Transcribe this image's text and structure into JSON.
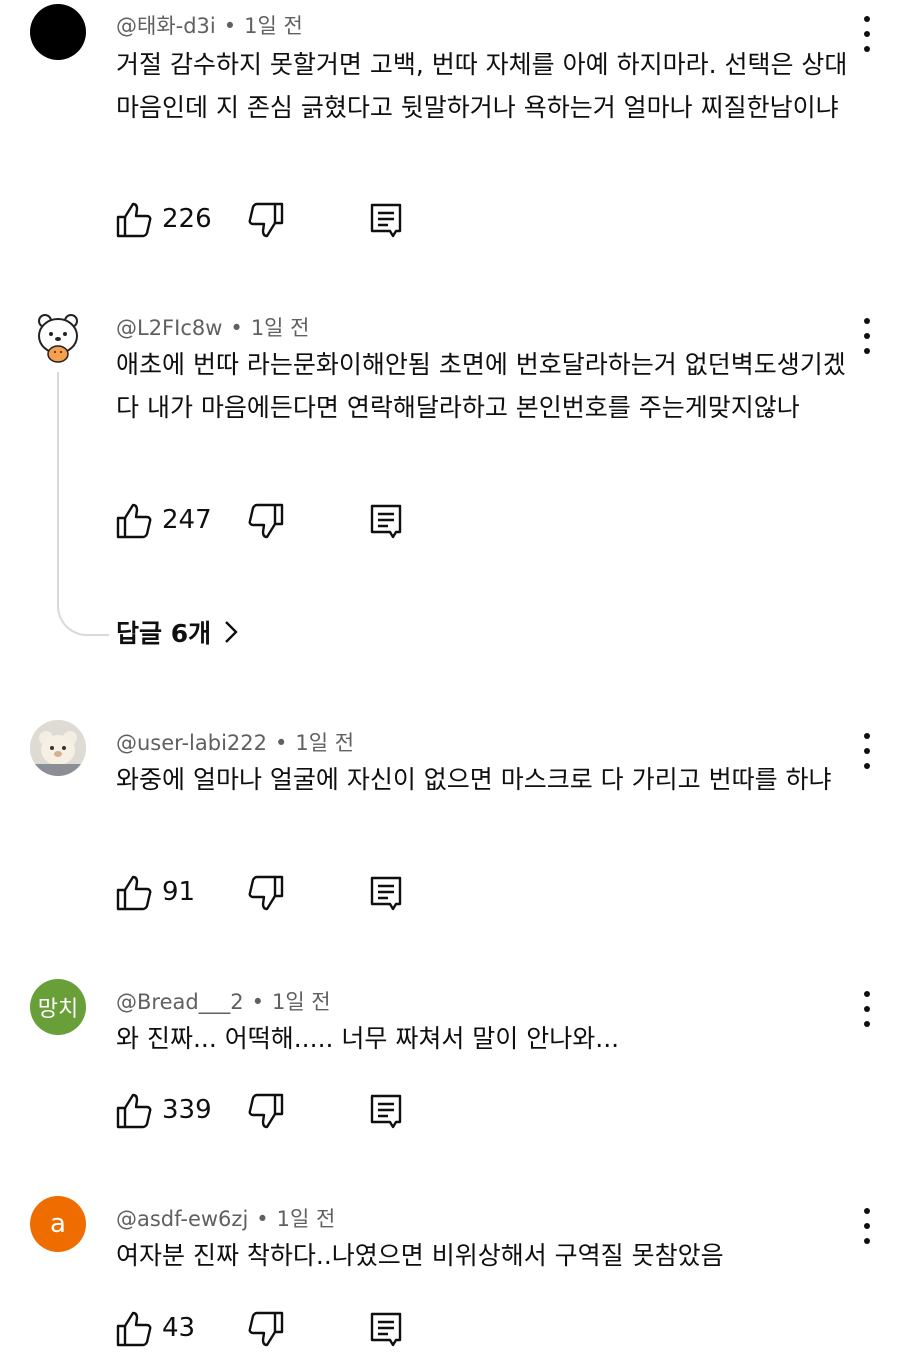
{
  "comments": [
    {
      "author": "@태화-d3i",
      "time": "1일 전",
      "text": "거절 감수하지 못할거면 고백, 번따 자체를 아예 하지마라. 선택은 상대 마음인데 지 존심 긁혔다고 뒷말하거나 욕하는거 얼마나 찌질한남이냐",
      "likes": "226",
      "avatar": {
        "type": "solid",
        "color": "#000000"
      }
    },
    {
      "author": "@L2FIc8w",
      "time": "1일 전",
      "text": "애초에 번따 라는문화이해안됨 초면에 번호달라하는거 없던벽도생기겠다 내가 마음에든다면 연락해달라하고 본인번호를 주는게맞지않나",
      "likes": "247",
      "avatar": {
        "type": "bear-illustration"
      },
      "replies_label": "답글 6개"
    },
    {
      "author": "@user-labi222",
      "time": "1일 전",
      "text": "와중에 얼마나 얼굴에 자신이 없으면 마스크로 다 가리고 번따를 하냐",
      "likes": "91",
      "avatar": {
        "type": "plush-photo"
      }
    },
    {
      "author": "@Bread___2",
      "time": "1일 전",
      "text": "와 진짜... 어떡해..... 너무 짜쳐서 말이 안나와...",
      "likes": "339",
      "avatar": {
        "type": "letter",
        "letter": "망치",
        "color": "#689f38"
      }
    },
    {
      "author": "@asdf-ew6zj",
      "time": "1일 전",
      "text": "여자분 진짜 착하다..나였으면 비위상해서 구역질 못참았음",
      "likes": "43",
      "avatar": {
        "type": "letter",
        "letter": "a",
        "color": "#ef6c00"
      }
    }
  ],
  "icons": {
    "like": "thumbs-up-icon",
    "dislike": "thumbs-down-icon",
    "reply": "reply-icon",
    "more": "more-vert-icon",
    "chevron": "chevron-right-icon"
  }
}
